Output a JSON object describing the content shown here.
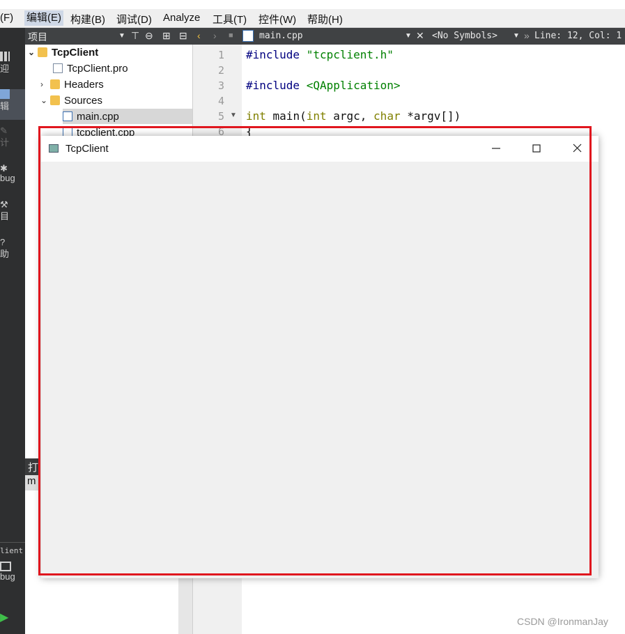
{
  "menubar": {
    "items": [
      "(F)",
      "编辑(E)",
      "构建(B)",
      "调试(D)",
      "Analyze",
      "工具(T)",
      "控件(W)",
      "帮助(H)"
    ],
    "active": "编辑(E)"
  },
  "toolbar": {
    "pane_title": "项目",
    "file_name": "main.cpp",
    "symbols": "<No Symbols>",
    "position": "Line: 12, Col: 1"
  },
  "modes": [
    "迎",
    "辑",
    "计",
    "bug",
    "目",
    "助",
    "lient",
    "bug"
  ],
  "tree": {
    "project": "TcpClient",
    "pro_file": "TcpClient.pro",
    "headers": "Headers",
    "sources": "Sources",
    "main": "main.cpp",
    "client_cpp": "tcpclient.cpp"
  },
  "bottom_pane": {
    "title": "打",
    "item": "m"
  },
  "editor": {
    "line_numbers": [
      "1",
      "2",
      "3",
      "4",
      "5",
      "6"
    ],
    "line1_directive": "#include",
    "line1_arg": "\"tcpclient.h\"",
    "line3_directive": "#include",
    "line3_arg": "<QApplication>",
    "line5_int": "int",
    "line5_main": " main(",
    "line5_int2": "int",
    "line5_argc": " argc, ",
    "line5_char": "char",
    "line5_rest": " *argv[])",
    "line6": "{"
  },
  "window": {
    "title": "TcpClient"
  },
  "watermark": "CSDN @IronmanJay",
  "colors": {
    "highlight_border": "#e0161e",
    "keyword": "#808000",
    "preprocessor": "#000080",
    "string": "#008000"
  }
}
